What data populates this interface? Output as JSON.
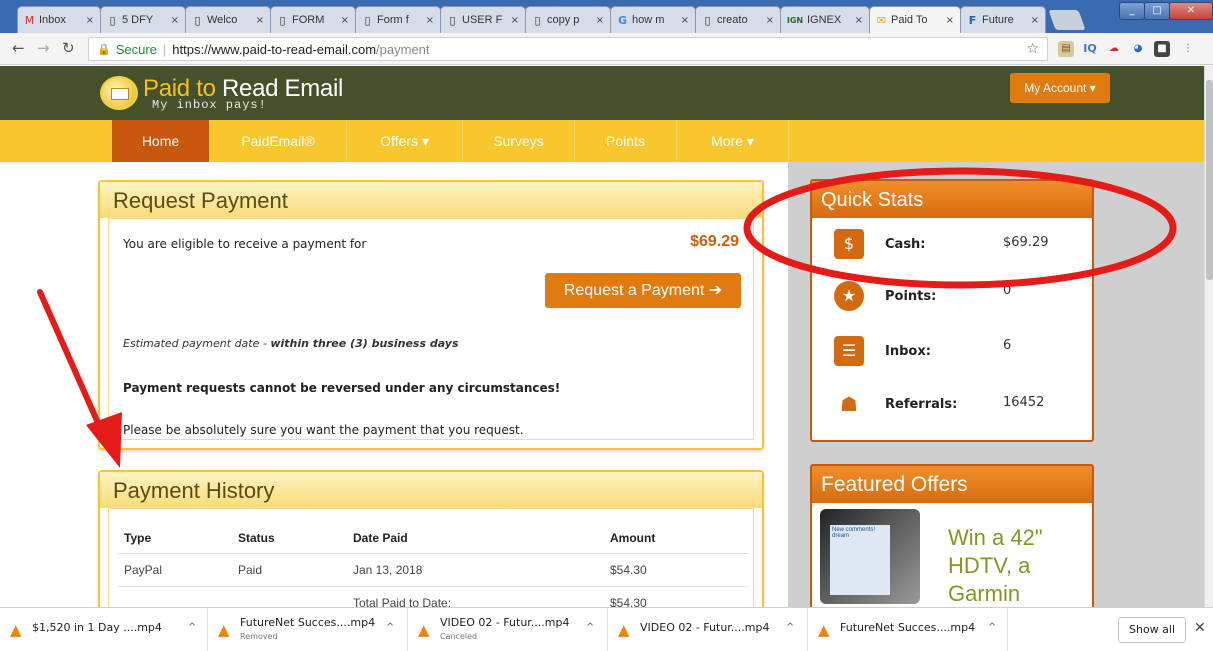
{
  "browser": {
    "tabs": [
      {
        "icon": "M",
        "label": "Inbox"
      },
      {
        "icon": "▯",
        "label": "5 DFY"
      },
      {
        "icon": "▯",
        "label": "Welco"
      },
      {
        "icon": "▯",
        "label": "FORM"
      },
      {
        "icon": "▯",
        "label": "Form f"
      },
      {
        "icon": "▯",
        "label": "USER F"
      },
      {
        "icon": "▯",
        "label": "copy p"
      },
      {
        "icon": "G",
        "label": "how m"
      },
      {
        "icon": "▯",
        "label": "creato"
      },
      {
        "icon": "IGN",
        "label": "IGNEX"
      },
      {
        "icon": "✉",
        "label": "Paid To"
      },
      {
        "icon": "F",
        "label": "Future"
      }
    ],
    "secure_label": "Secure",
    "url_host": "https://www.paid-to-read-email.com",
    "url_path": "/payment"
  },
  "site": {
    "logo_title_accent": "Paid to",
    "logo_title_rest": " Read Email",
    "logo_tagline": "My inbox pays!",
    "my_account": "My Account ▾",
    "nav": [
      "Home",
      "PaidEmail®",
      "Offers ▾",
      "Surveys",
      "Points",
      "More ▾"
    ]
  },
  "request_payment": {
    "title": "Request Payment",
    "eligible_text": "You are eligible to receive a payment for",
    "amount": "$69.29",
    "button": "Request a Payment ➔",
    "estimate_prefix": "Estimated payment date - ",
    "estimate_bold": "within three (3) business days",
    "warning": "Payment requests cannot be reversed under any circumstances!",
    "note": "Please be absolutely sure you want the payment that you request."
  },
  "payment_history": {
    "title": "Payment History",
    "columns": [
      "Type",
      "Status",
      "Date Paid",
      "Amount"
    ],
    "rows": [
      [
        "PayPal",
        "Paid",
        "Jan 13, 2018",
        "$54.30"
      ],
      [
        "",
        "",
        "Total Paid to Date:",
        "$54.30"
      ]
    ]
  },
  "quick_stats": {
    "title": "Quick Stats",
    "items": [
      {
        "label": "Cash:",
        "value": "$69.29",
        "icon": "cash-icon",
        "glyph": "$"
      },
      {
        "label": "Points:",
        "value": "0",
        "icon": "star-icon",
        "glyph": "★"
      },
      {
        "label": "Inbox:",
        "value": "6",
        "icon": "inbox-icon",
        "glyph": "☰"
      },
      {
        "label": "Referrals:",
        "value": "16452",
        "icon": "referrals-icon",
        "glyph": "☗"
      }
    ]
  },
  "featured_offers": {
    "title": "Featured Offers",
    "promo_text": "Win a 42\" HDTV, a Garmin",
    "screen_text": "New comments! dream"
  },
  "downloads": [
    {
      "name": "$1,520 in 1 Day ....mp4",
      "status": ""
    },
    {
      "name": "FutureNet Succes....mp4",
      "status": "Removed"
    },
    {
      "name": "VIDEO 02 - Futur....mp4",
      "status": "Canceled"
    },
    {
      "name": "VIDEO 02 - Futur....mp4",
      "status": ""
    },
    {
      "name": "FutureNet Succes....mp4",
      "status": ""
    }
  ],
  "downloads_show_all": "Show all",
  "colors": {
    "header": "#44512a",
    "nav": "#f7c72d",
    "accent": "#e07b12",
    "annotation": "#e41b17"
  }
}
